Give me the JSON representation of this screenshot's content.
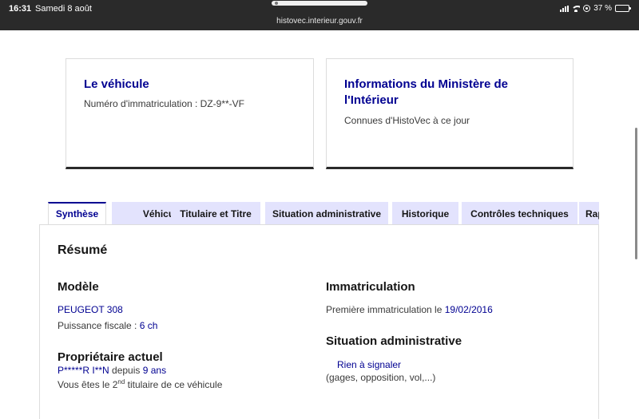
{
  "status_bar": {
    "time": "16:31",
    "date": "Samedi 8 août",
    "url": "histovec.interieur.gouv.fr",
    "battery": "37 %",
    "battery_level": 0.37
  },
  "cards": {
    "vehicle": {
      "title": "Le véhicule",
      "text": "Numéro d'immatriculation : DZ-9**-VF"
    },
    "ministry": {
      "title": "Informations du Ministère de l'Intérieur",
      "text": "Connues d'HistoVec à ce jour"
    }
  },
  "tabs": [
    {
      "label": "Synthèse",
      "active": true
    },
    {
      "label": "Véhicule",
      "active": false
    },
    {
      "label": "Titulaire et Titre",
      "active": false
    },
    {
      "label": "Situation administrative",
      "active": false
    },
    {
      "label": "Historique",
      "active": false
    },
    {
      "label": "Contrôles techniques",
      "active": false
    },
    {
      "label": "Rap",
      "active": false
    }
  ],
  "summary": {
    "heading": "Résumé",
    "model": {
      "heading": "Modèle",
      "name": "PEUGEOT 308",
      "power_label": "Puissance fiscale : ",
      "power_value": "6 ch"
    },
    "owner": {
      "heading": "Propriétaire actuel",
      "name": "P*****R I**N",
      "since_label": " depuis ",
      "since_value": "9 ans",
      "rank_prefix": "Vous êtes le 2",
      "rank_sup": "nd",
      "rank_suffix": " titulaire de ce véhicule"
    },
    "registration": {
      "heading": "Immatriculation",
      "first_label": "Première immatriculation le ",
      "first_date": "19/02/2016"
    },
    "admin": {
      "heading": "Situation administrative",
      "status": "Rien à signaler",
      "detail": "(gages, opposition, vol,...)"
    }
  }
}
